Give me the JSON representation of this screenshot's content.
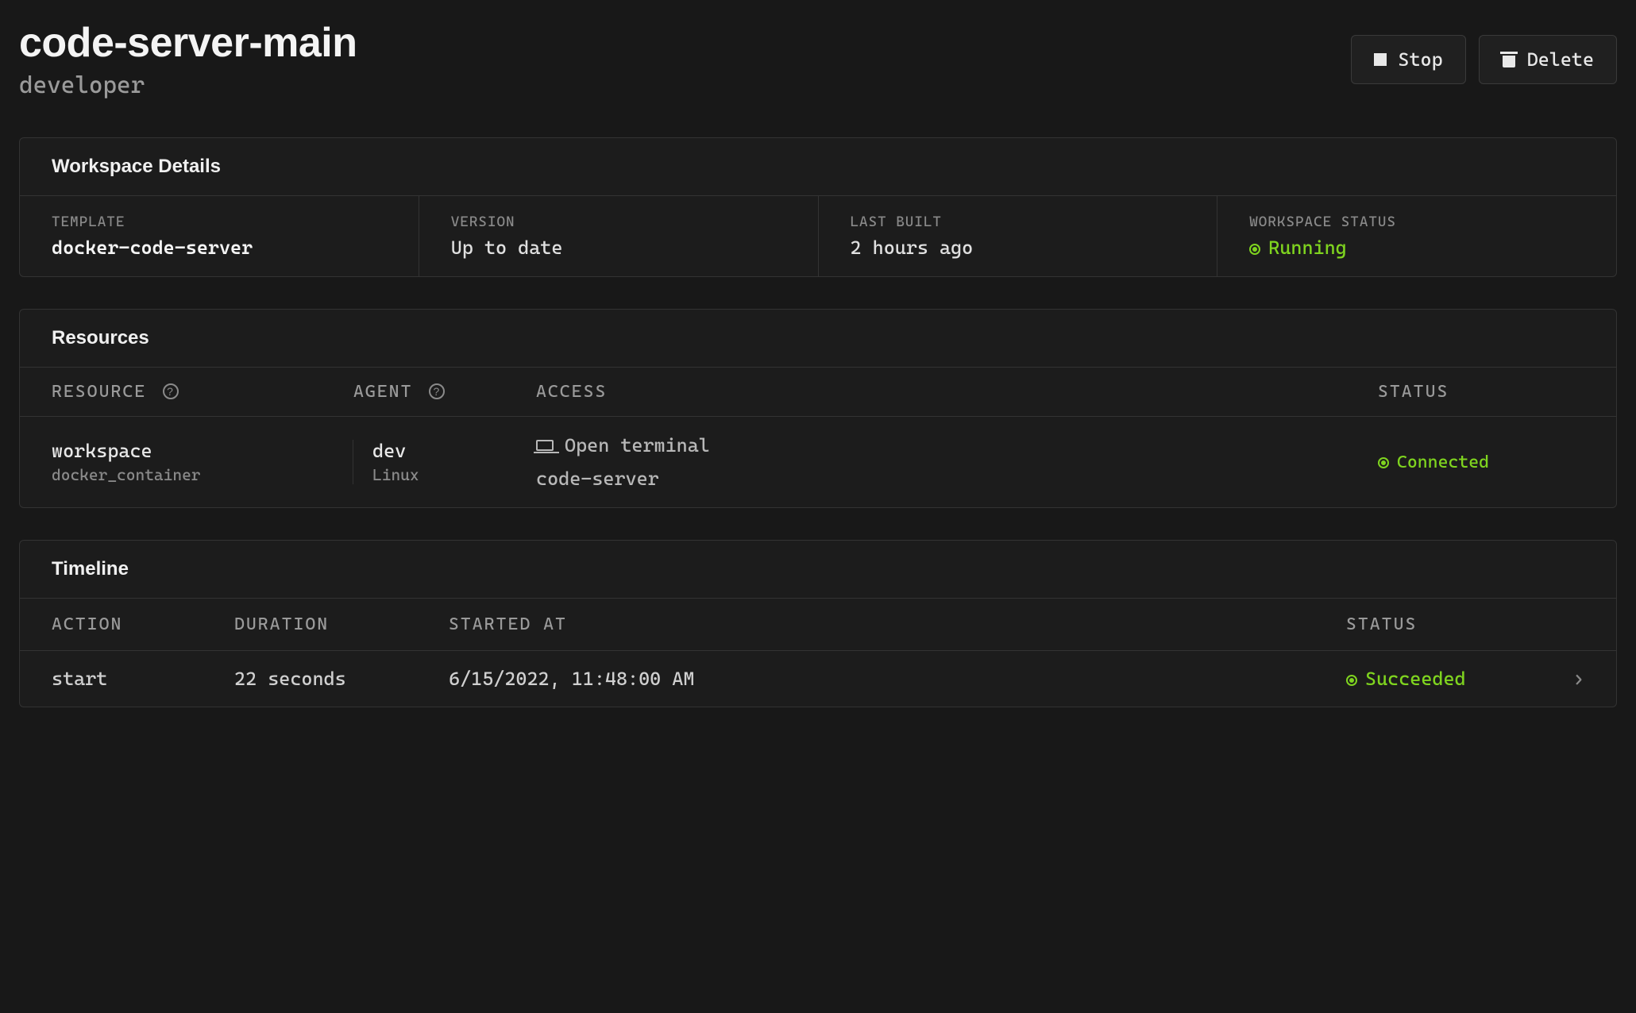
{
  "header": {
    "title": "code-server-main",
    "subtitle": "developer",
    "stop_label": "Stop",
    "delete_label": "Delete"
  },
  "details": {
    "section_title": "Workspace Details",
    "template_label": "TEMPLATE",
    "template_value": "docker-code-server",
    "version_label": "VERSION",
    "version_value": "Up to date",
    "last_built_label": "LAST BUILT",
    "last_built_value": "2 hours ago",
    "status_label": "WORKSPACE STATUS",
    "status_value": "Running"
  },
  "resources": {
    "section_title": "Resources",
    "head_resource": "RESOURCE",
    "head_agent": "AGENT",
    "head_access": "ACCESS",
    "head_status": "STATUS",
    "row": {
      "name": "workspace",
      "type": "docker_container",
      "agent_name": "dev",
      "agent_os": "Linux",
      "access_terminal": "Open terminal",
      "access_app": "code-server",
      "status": "Connected"
    }
  },
  "timeline": {
    "section_title": "Timeline",
    "head_action": "ACTION",
    "head_duration": "DURATION",
    "head_started": "STARTED AT",
    "head_status": "STATUS",
    "row": {
      "action": "start",
      "duration": "22 seconds",
      "started_at": "6/15/2022, 11:48:00 AM",
      "status": "Succeeded"
    }
  }
}
